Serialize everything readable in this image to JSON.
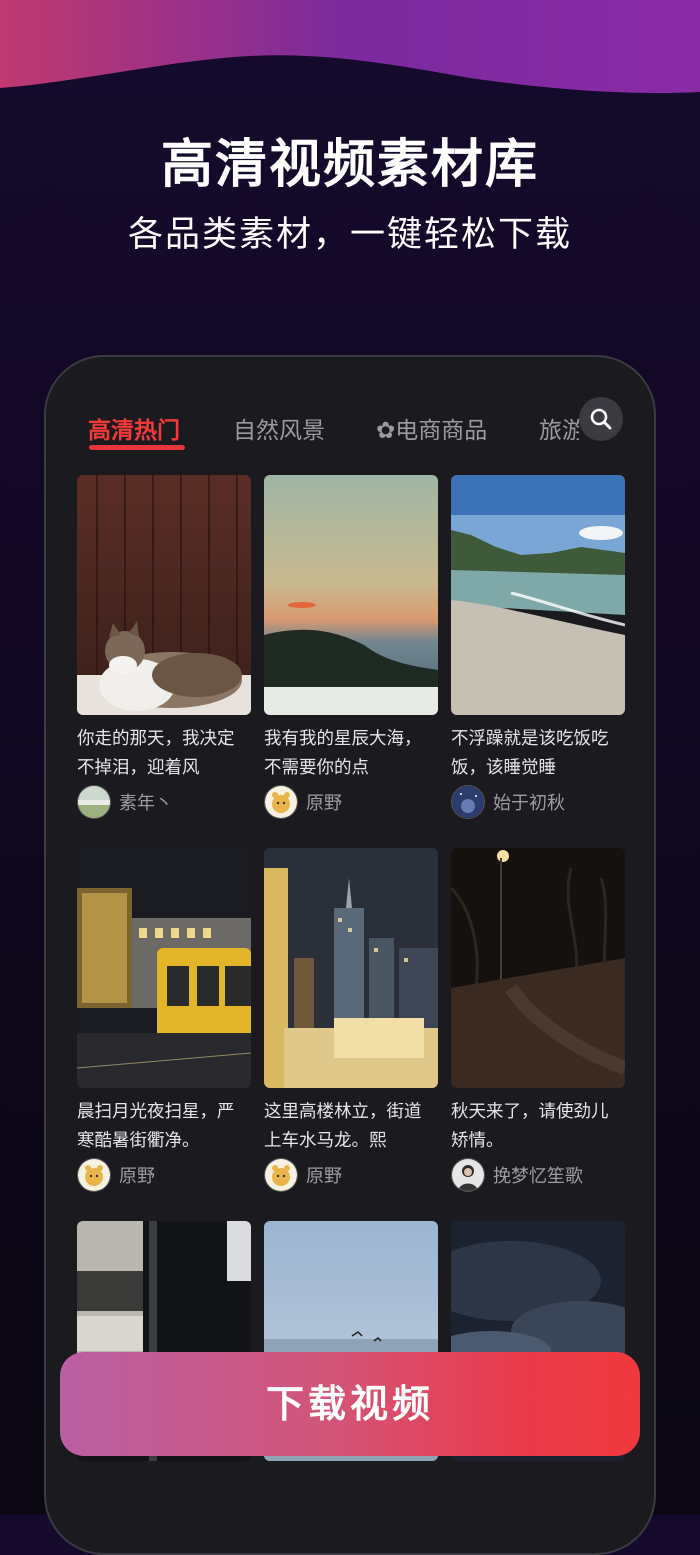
{
  "header": {
    "title": "高清视频素材库",
    "subtitle": "各品类素材，一键轻松下载"
  },
  "tabs": [
    {
      "label": "高清热门",
      "active": true
    },
    {
      "label": "自然风景",
      "active": false
    },
    {
      "label": "✿电商商品",
      "active": false
    },
    {
      "label": "旅游",
      "active": false
    }
  ],
  "search_icon": "search-icon",
  "videos": [
    {
      "caption": "你走的那天，我决定不掉泪，迎着风",
      "author": "素年丶",
      "thumb": "cat on fur rug",
      "avatar": "landscape"
    },
    {
      "caption": "我有我的星辰大海，不需要你的点",
      "author": "原野",
      "thumb": "sunset over sea",
      "avatar": "cartoon-bear"
    },
    {
      "caption": "不浮躁就是该吃饭吃饭，该睡觉睡",
      "author": "始于初秋",
      "thumb": "beach and mountains",
      "avatar": "night-sky"
    },
    {
      "caption": "晨扫月光夜扫星，严寒酷暑街衢净。",
      "author": "原野",
      "thumb": "city street bus at night",
      "avatar": "cartoon-bear"
    },
    {
      "caption": "这里高楼林立，街道上车水马龙。熙",
      "author": "原野",
      "thumb": "city skyline at night",
      "avatar": "cartoon-bear"
    },
    {
      "caption": "秋天来了，请使劲儿矫情。",
      "author": "挽梦忆笙歌",
      "thumb": "park path at night",
      "avatar": "portrait"
    },
    {
      "caption": "",
      "author": "",
      "thumb": "billboard at night",
      "avatar": ""
    },
    {
      "caption": "",
      "author": "",
      "thumb": "sea with birds",
      "avatar": ""
    },
    {
      "caption": "",
      "author": "",
      "thumb": "dark clouds",
      "avatar": ""
    }
  ],
  "download_button": {
    "label": "下载视频"
  },
  "colors": {
    "accent_red": "#e8343a",
    "background": "#120824",
    "card_bg": "#1b1b1f",
    "button_gradient_start": "#b95fa3",
    "button_gradient_end": "#f0393e"
  }
}
